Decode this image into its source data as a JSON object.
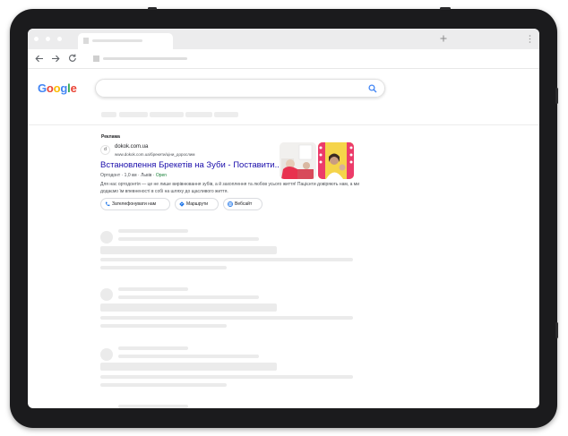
{
  "browser": {
    "tab_add_icon": "plus-icon",
    "nav_icons": [
      "back-arrow-icon",
      "forward-arrow-icon",
      "reload-icon"
    ]
  },
  "google": {
    "logo_letters": [
      {
        "ch": "G",
        "color": "#4285F4"
      },
      {
        "ch": "o",
        "color": "#EA4335"
      },
      {
        "ch": "o",
        "color": "#FBBC05"
      },
      {
        "ch": "g",
        "color": "#4285F4"
      },
      {
        "ch": "l",
        "color": "#34A853"
      },
      {
        "ch": "e",
        "color": "#EA4335"
      }
    ],
    "search_icon": "magnifier-icon",
    "search_icon_color": "#4285F4"
  },
  "ad": {
    "label": "Реклама",
    "site_icon_text": "d",
    "domain": "dokok.com.ua",
    "path": "www.dokok.com.ua/брекети/цiни_дорослим",
    "title": "Встановлення Брекетів на Зуби - Поставити...",
    "meta": "Ортодонт · 1,0 км · Львів · ",
    "status": "Open",
    "description": "Для нас ортодонтія — це не лише вирівнювання зубів, а й захоплення та любов усього життя! Пацієнти довіряють нам, а ми додаємо їм впевненості в собі на шляху до щасливого життя.",
    "actions": [
      {
        "label": "Зателефонувати нам",
        "icon": "phone-icon"
      },
      {
        "label": "Маршрути",
        "icon": "directions-icon"
      },
      {
        "label": "Вебсайт",
        "icon": "globe-icon"
      }
    ],
    "colors": {
      "title": "#1a0dab",
      "open": "#188038",
      "accent": "#1a73e8"
    }
  }
}
